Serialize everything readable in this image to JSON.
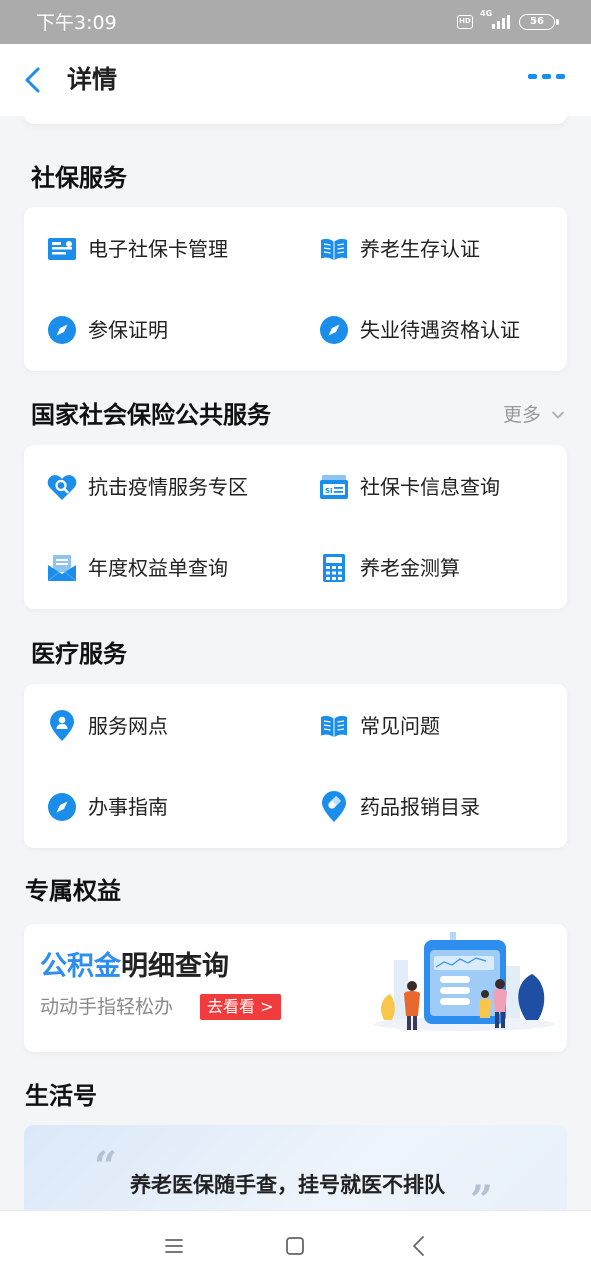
{
  "status_bar": {
    "time": "下午3:09",
    "hd": "HD",
    "network": "4G",
    "battery": "56"
  },
  "nav": {
    "title": "详情"
  },
  "sections": {
    "social_security": {
      "title": "社保服务",
      "items": [
        "电子社保卡管理",
        "养老生存认证",
        "参保证明",
        "失业待遇资格认证"
      ]
    },
    "national_public": {
      "title": "国家社会保险公共服务",
      "more_label": "更多",
      "items": [
        "抗击疫情服务专区",
        "社保卡信息查询",
        "年度权益单查询",
        "养老金测算"
      ]
    },
    "medical": {
      "title": "医疗服务",
      "items": [
        "服务网点",
        "常见问题",
        "办事指南",
        "药品报销目录"
      ]
    },
    "exclusive": {
      "title": "专属权益",
      "banner": {
        "title_accent": "公积金",
        "title_rest": "明细查询",
        "subtitle": "动动手指轻松办",
        "button": "去看看 >"
      }
    },
    "life": {
      "title": "生活号",
      "quote_open": "“",
      "quote_text": "养老医保随手查，挂号就医不排队",
      "quote_close": "”"
    }
  },
  "icons": {
    "accent_color": "#1a8eea",
    "social_security": [
      "ecard-icon",
      "book-icon",
      "compass-icon",
      "compass-icon"
    ],
    "national_public": [
      "heart-search-icon",
      "card-icon",
      "document-icon",
      "calculator-icon"
    ],
    "medical": [
      "location-person-icon",
      "book-icon",
      "compass-icon",
      "pill-location-icon"
    ]
  }
}
